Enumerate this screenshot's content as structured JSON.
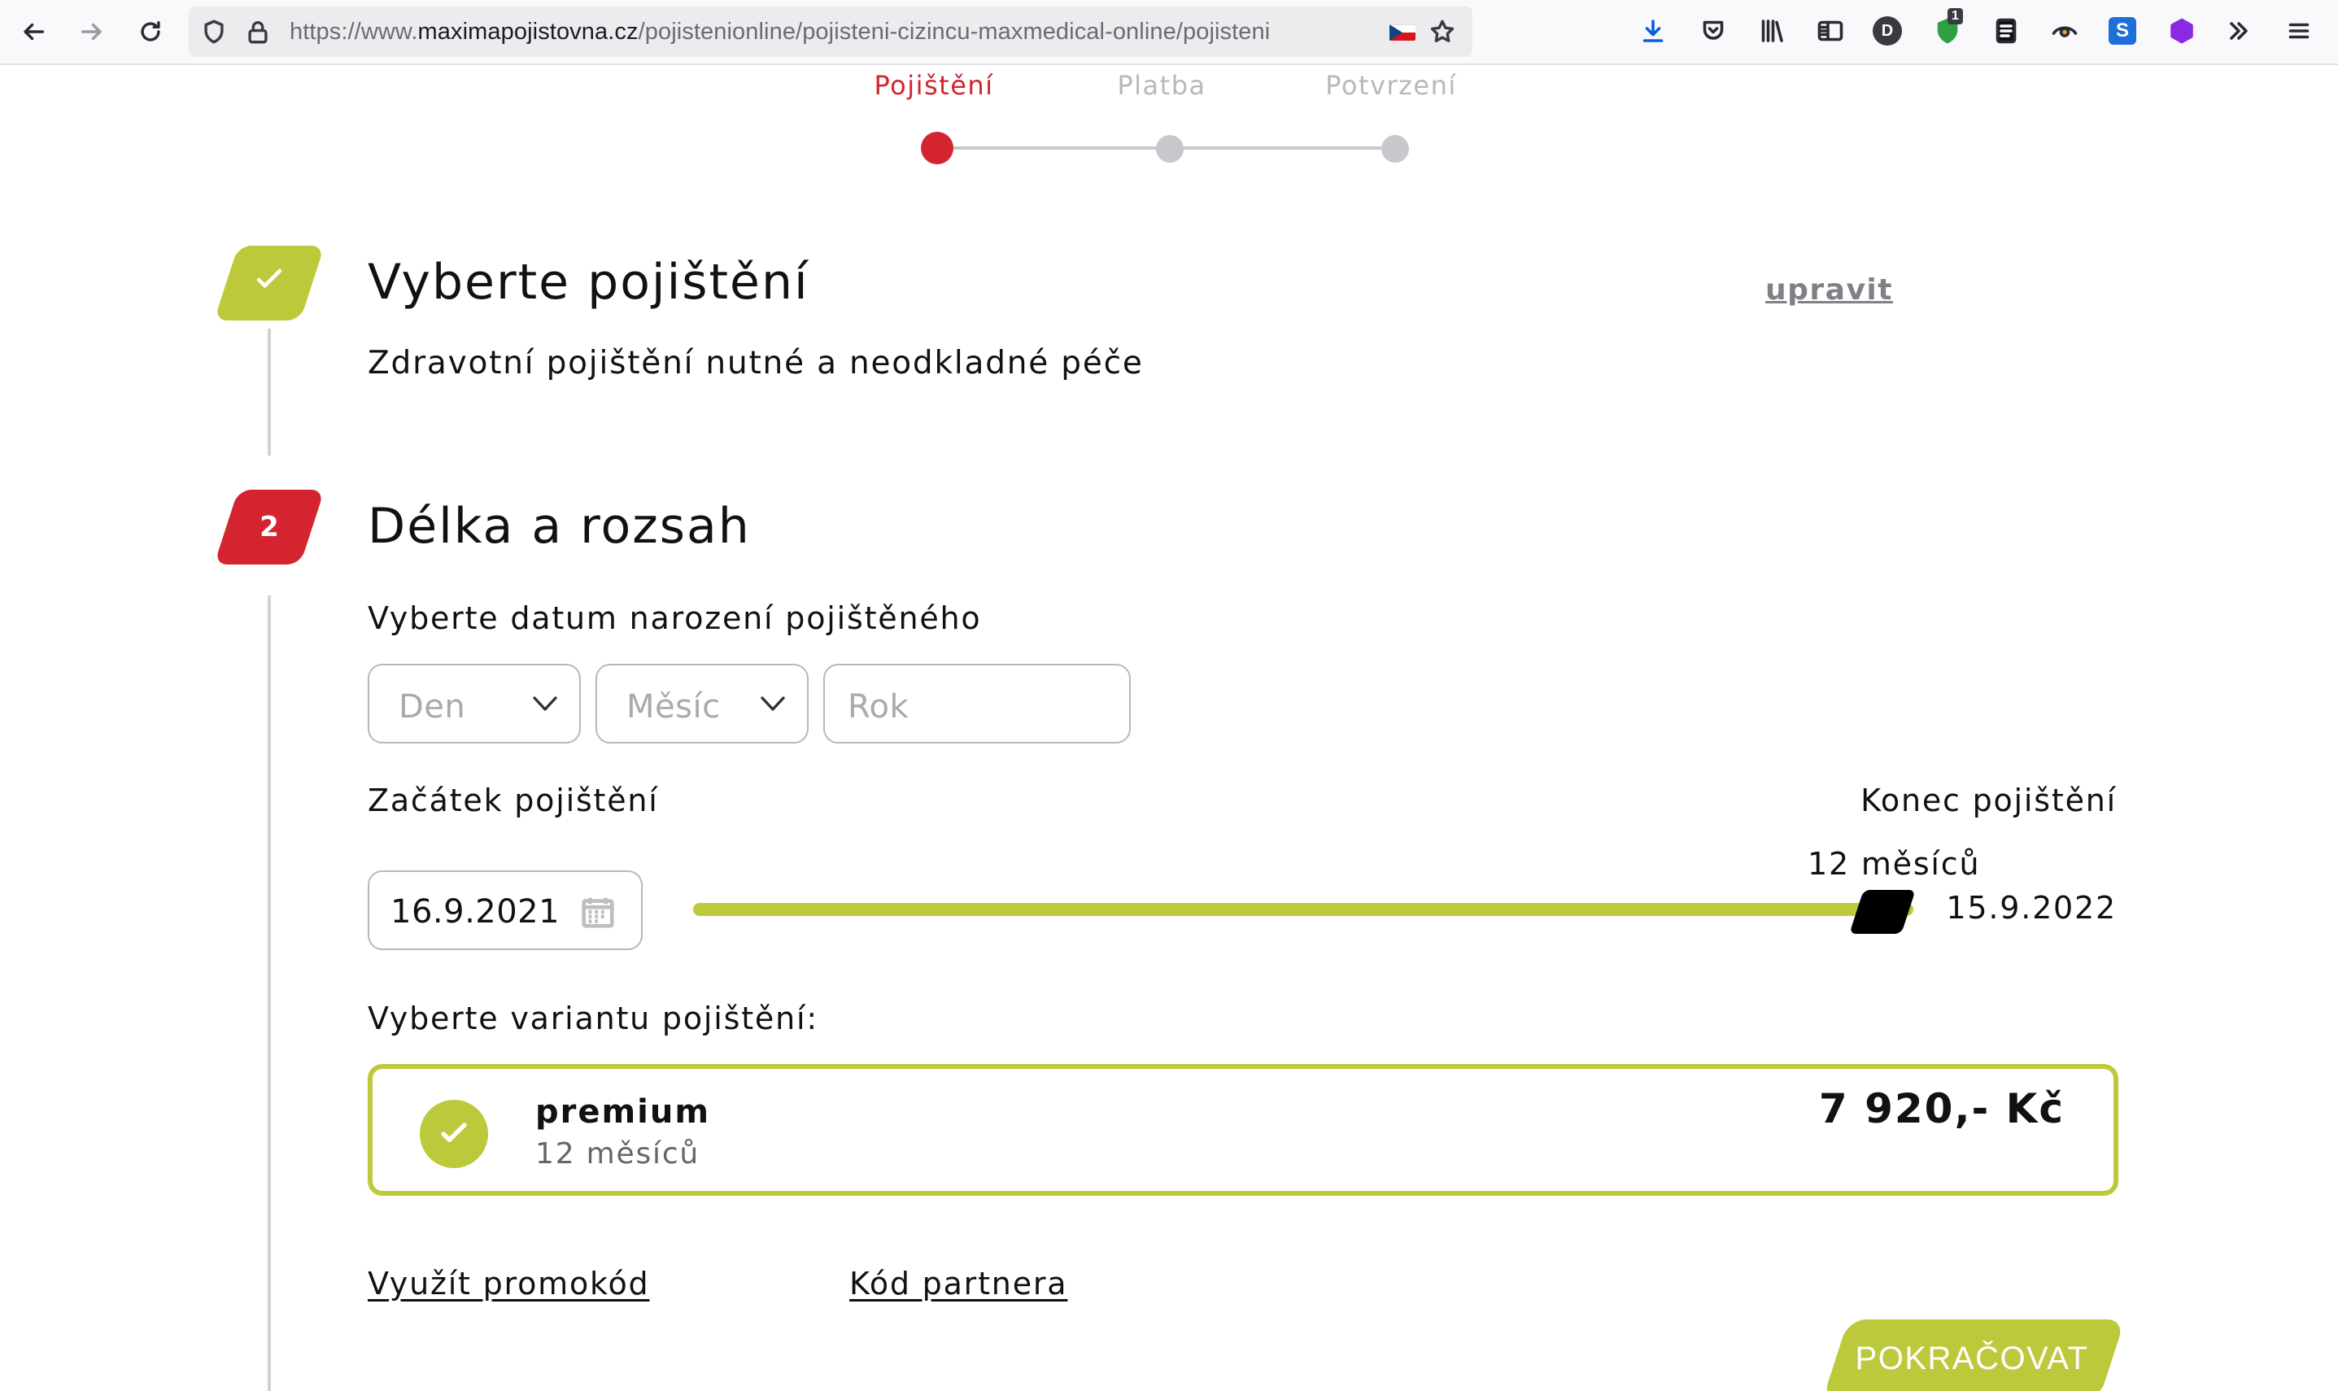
{
  "browser": {
    "url_prefix": "https://www.",
    "url_domain": "maximapojistovna.cz",
    "url_path": "/pojistenionline/pojisteni-cizincu-maxmedical-online/pojisteni",
    "extension_badge_count": "1",
    "extension_letter_d": "D",
    "extension_letter_s": "S"
  },
  "steps": [
    {
      "label": "Pojištění",
      "active": true
    },
    {
      "label": "Platba",
      "active": false
    },
    {
      "label": "Potvrzení",
      "active": false
    }
  ],
  "section1": {
    "title": "Vyberte pojištění",
    "edit_link": "upravit",
    "selected_product": "Zdravotní pojištění nutné a neodkladné péče"
  },
  "section2": {
    "number": "2",
    "title": "Délka a rozsah",
    "birthdate_label": "Vyberte datum narození pojištěného",
    "day_placeholder": "Den",
    "month_placeholder": "Měsíc",
    "year_placeholder": "Rok",
    "start_label": "Začátek pojištění",
    "end_label": "Konec pojištění",
    "start_date": "16.9.2021",
    "duration_label": "12 měsíců",
    "duration_fraction": 1.0,
    "end_date": "15.9.2022",
    "variant_label": "Vyberte variantu pojištění:",
    "variant": {
      "name": "premium",
      "duration": "12 měsíců",
      "price": "7 920,- Kč",
      "selected": true
    },
    "promo_link": "Využít promokód",
    "partner_link": "Kód partnera",
    "continue_button": "POKRAČOVAT"
  },
  "colors": {
    "accent_green": "#bcc93a",
    "accent_red": "#d3242f"
  }
}
